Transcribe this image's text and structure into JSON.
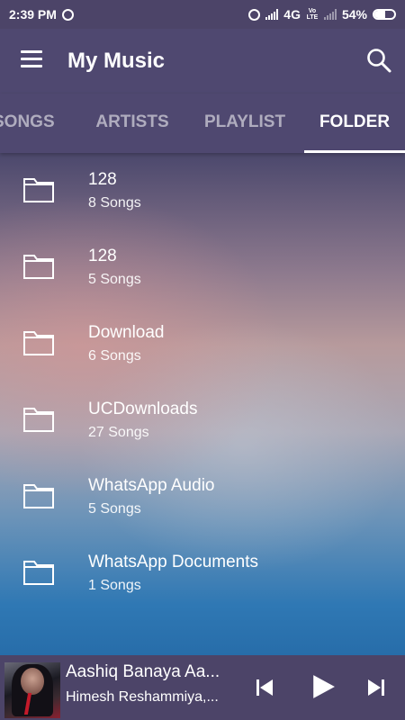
{
  "status_bar": {
    "time": "2:39 PM",
    "network": "4G",
    "volte": "Vo LTE",
    "battery": "54%",
    "battery_level": 0.54,
    "icons": [
      "whatsapp-icon",
      "alarm-icon",
      "signal-icon",
      "battery-icon"
    ]
  },
  "app_bar": {
    "title": "My Music",
    "icons": [
      "menu-icon",
      "search-icon"
    ]
  },
  "tabs": [
    {
      "label": "SONGS",
      "active": false
    },
    {
      "label": "ARTISTS",
      "active": false
    },
    {
      "label": "PLAYLIST",
      "active": false
    },
    {
      "label": "FOLDER",
      "active": true
    }
  ],
  "folders": [
    {
      "name": "128",
      "count": "8 Songs"
    },
    {
      "name": "128",
      "count": "5 Songs"
    },
    {
      "name": "Download",
      "count": "6 Songs"
    },
    {
      "name": "UCDownloads",
      "count": "27 Songs"
    },
    {
      "name": "WhatsApp Audio",
      "count": "5 Songs"
    },
    {
      "name": "WhatsApp Documents",
      "count": "1 Songs"
    }
  ],
  "now_playing": {
    "title": "Aashiq Banaya Aa...",
    "artist": "Himesh Reshammiya,...",
    "controls": [
      "previous-icon",
      "play-icon",
      "next-icon"
    ]
  },
  "colors": {
    "bar_background": "#4f4870",
    "status_background": "#4c4468",
    "text": "#ffffff"
  }
}
